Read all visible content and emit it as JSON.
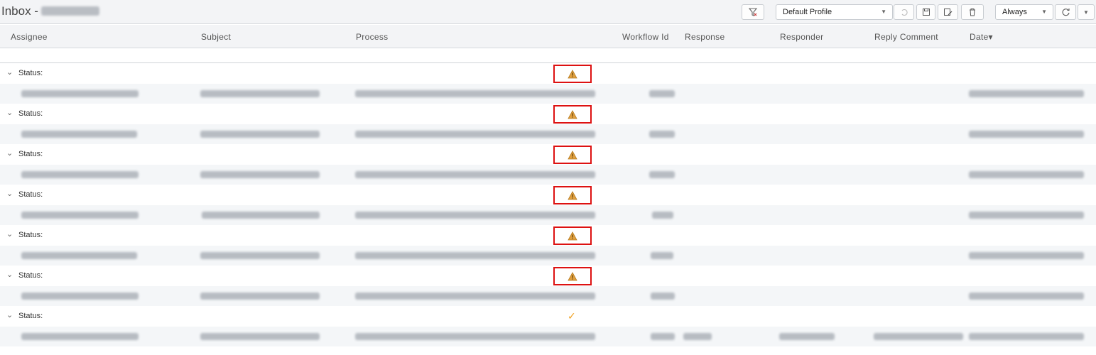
{
  "toolbar": {
    "title": "Inbox -",
    "profile_select": "Default Profile",
    "refresh_select": "Always",
    "filter_icon": "filter-icon",
    "undo_icon": "undo-icon",
    "save_icon": "save-icon",
    "save_as_icon": "save-as-icon",
    "delete_icon": "trash-icon",
    "refresh_icon": "refresh-icon"
  },
  "columns": [
    "Assignee",
    "Subject",
    "Process",
    "Workflow Id",
    "Response",
    "Responder",
    "Reply Comment",
    "Date▾"
  ],
  "groups": [
    {
      "label": "Status:",
      "status_icon": "warning",
      "highlighted": true
    },
    {
      "label": "Status:",
      "status_icon": "warning",
      "highlighted": true
    },
    {
      "label": "Status:",
      "status_icon": "warning",
      "highlighted": true
    },
    {
      "label": "Status:",
      "status_icon": "warning",
      "highlighted": true
    },
    {
      "label": "Status:",
      "status_icon": "warning",
      "highlighted": true
    },
    {
      "label": "Status:",
      "status_icon": "warning",
      "highlighted": true
    },
    {
      "label": "Status:",
      "status_icon": "check",
      "highlighted": false
    }
  ],
  "colors": {
    "highlight_border": "#dd1111",
    "warning": "#e0a040",
    "check": "#f0a020"
  }
}
